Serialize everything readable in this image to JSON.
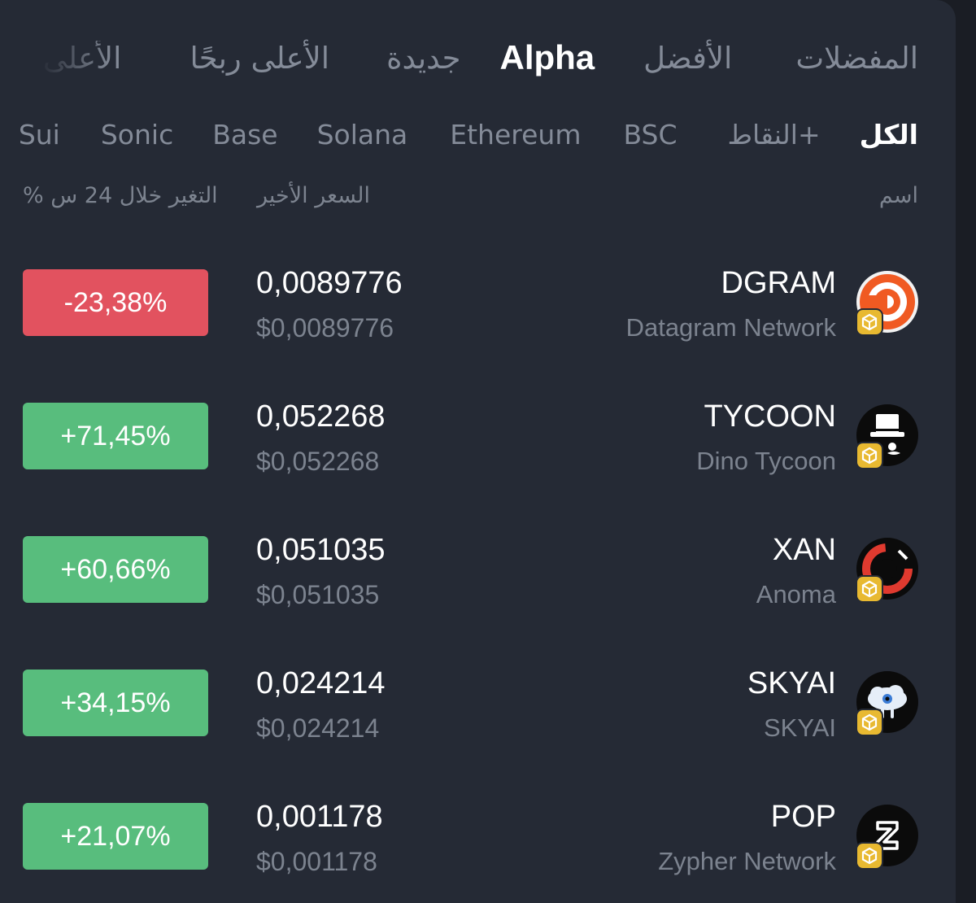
{
  "tabs": [
    {
      "label": "المفضلات"
    },
    {
      "label": "الأفضل"
    },
    {
      "label": "Alpha"
    },
    {
      "label": "جديدة"
    },
    {
      "label": "الأعلى ربحًا"
    },
    {
      "label": "الأعلى"
    }
  ],
  "active_tab": "Alpha",
  "chains": [
    {
      "label": "الكل"
    },
    {
      "label": "النقاط+"
    },
    {
      "label": "BSC"
    },
    {
      "label": "Ethereum"
    },
    {
      "label": "Solana"
    },
    {
      "label": "Base"
    },
    {
      "label": "Sonic"
    },
    {
      "label": "Sui"
    }
  ],
  "active_chain": "الكل",
  "columns": {
    "name": "اسم",
    "last_price": "السعر الأخير",
    "change": "% التغير خلال 24 س"
  },
  "colors": {
    "up": "#58bd7d",
    "down": "#e2525f",
    "chain_chip": "#e8b931"
  },
  "tokens": [
    {
      "symbol": "DGRAM",
      "name": "Datagram Network",
      "price": "0,0089776",
      "price_usd": "$0,0089776",
      "change": "-23,38%",
      "direction": "down",
      "icon": "datagram-logo-icon"
    },
    {
      "symbol": "TYCOON",
      "name": "Dino Tycoon",
      "price": "0,052268",
      "price_usd": "$0,052268",
      "change": "+71,45%",
      "direction": "up",
      "icon": "top-hat-logo-icon"
    },
    {
      "symbol": "XAN",
      "name": "Anoma",
      "price": "0,051035",
      "price_usd": "$0,051035",
      "change": "+60,66%",
      "direction": "up",
      "icon": "anoma-ring-logo-icon"
    },
    {
      "symbol": "SKYAI",
      "name": "SKYAI",
      "price": "0,024214",
      "price_usd": "$0,024214",
      "change": "+34,15%",
      "direction": "up",
      "icon": "cloud-eye-logo-icon"
    },
    {
      "symbol": "POP",
      "name": "Zypher Network",
      "price": "0,001178",
      "price_usd": "$0,001178",
      "change": "+21,07%",
      "direction": "up",
      "icon": "zypher-logo-icon"
    }
  ]
}
